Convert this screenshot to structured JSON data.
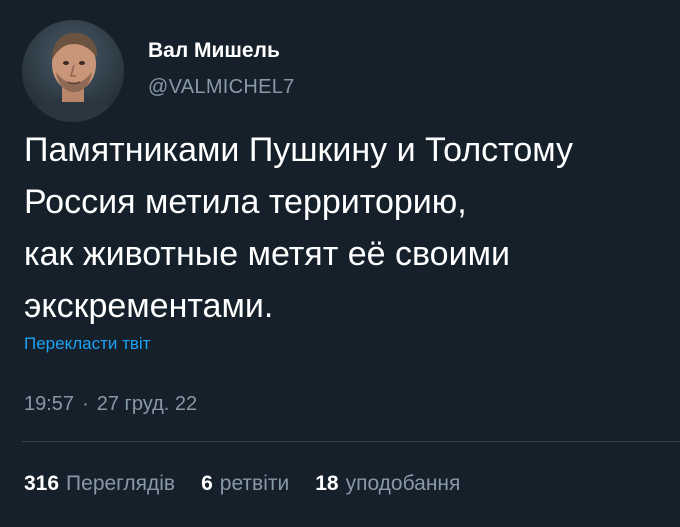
{
  "author": {
    "display_name": "Вал Мишель",
    "handle": "@VALMICHEL7"
  },
  "tweet": {
    "lines": [
      "Памятниками Пушкину и Толстому",
      "Россия метила территорию,",
      "как животные метят её своими",
      "экскрементами."
    ],
    "translate_label": "Перекласти твіт",
    "time": "19:57",
    "separator": "·",
    "date": "27 груд. 22"
  },
  "stats": [
    {
      "count": "316",
      "label": "Переглядів"
    },
    {
      "count": "6",
      "label": "ретвіти"
    },
    {
      "count": "18",
      "label": "уподобання"
    }
  ],
  "colors": {
    "background": "#15202b",
    "text": "#ffffff",
    "secondary": "#8899a6",
    "link": "#1da1f2",
    "divider": "#38444d"
  }
}
